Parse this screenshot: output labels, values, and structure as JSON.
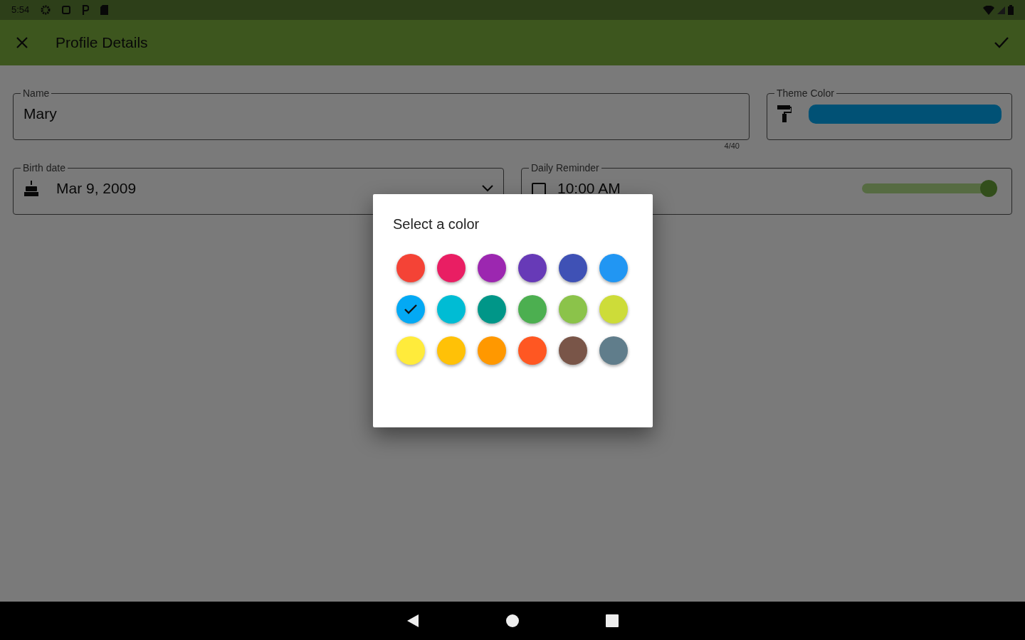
{
  "status_bar": {
    "time": "5:54"
  },
  "toolbar": {
    "title": "Profile Details"
  },
  "form": {
    "name": {
      "label": "Name",
      "value": "Mary",
      "counter": "4/40"
    },
    "theme_color": {
      "label": "Theme Color"
    },
    "birth_date": {
      "label": "Birth date",
      "value": "Mar 9, 2009"
    },
    "daily_reminder": {
      "label": "Daily Reminder",
      "value": "10:00 AM",
      "on": true
    }
  },
  "dialog": {
    "title": "Select a color",
    "swatches": [
      {
        "color": "#f44336",
        "selected": false
      },
      {
        "color": "#e91e63",
        "selected": false
      },
      {
        "color": "#9c27b0",
        "selected": false
      },
      {
        "color": "#673ab7",
        "selected": false
      },
      {
        "color": "#3f51b5",
        "selected": false
      },
      {
        "color": "#2196f3",
        "selected": false
      },
      {
        "color": "#03a9f4",
        "selected": true
      },
      {
        "color": "#00bcd4",
        "selected": false
      },
      {
        "color": "#009688",
        "selected": false
      },
      {
        "color": "#4caf50",
        "selected": false
      },
      {
        "color": "#8bc34a",
        "selected": false
      },
      {
        "color": "#cddc39",
        "selected": false
      },
      {
        "color": "#ffeb3b",
        "selected": false
      },
      {
        "color": "#ffc107",
        "selected": false
      },
      {
        "color": "#ff9800",
        "selected": false
      },
      {
        "color": "#ff5722",
        "selected": false
      },
      {
        "color": "#795548",
        "selected": false
      },
      {
        "color": "#607d8b",
        "selected": false
      }
    ]
  }
}
